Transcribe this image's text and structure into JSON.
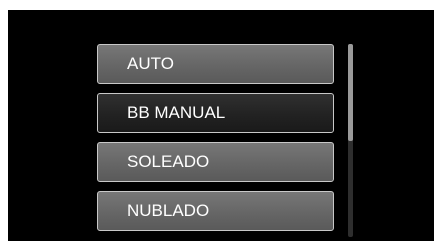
{
  "menu": {
    "items": [
      {
        "label": "AUTO",
        "selected": false
      },
      {
        "label": "BB MANUAL",
        "selected": true
      },
      {
        "label": "SOLEADO",
        "selected": false
      },
      {
        "label": "NUBLADO",
        "selected": false
      }
    ],
    "scroll_position_fraction": 0.0,
    "visible_fraction": 0.5
  },
  "colors": {
    "screen_background": "#000000",
    "item_background": "#666666",
    "selected_background": "#222222",
    "item_text": "#ffffff",
    "item_border": "#c8c8c8"
  }
}
